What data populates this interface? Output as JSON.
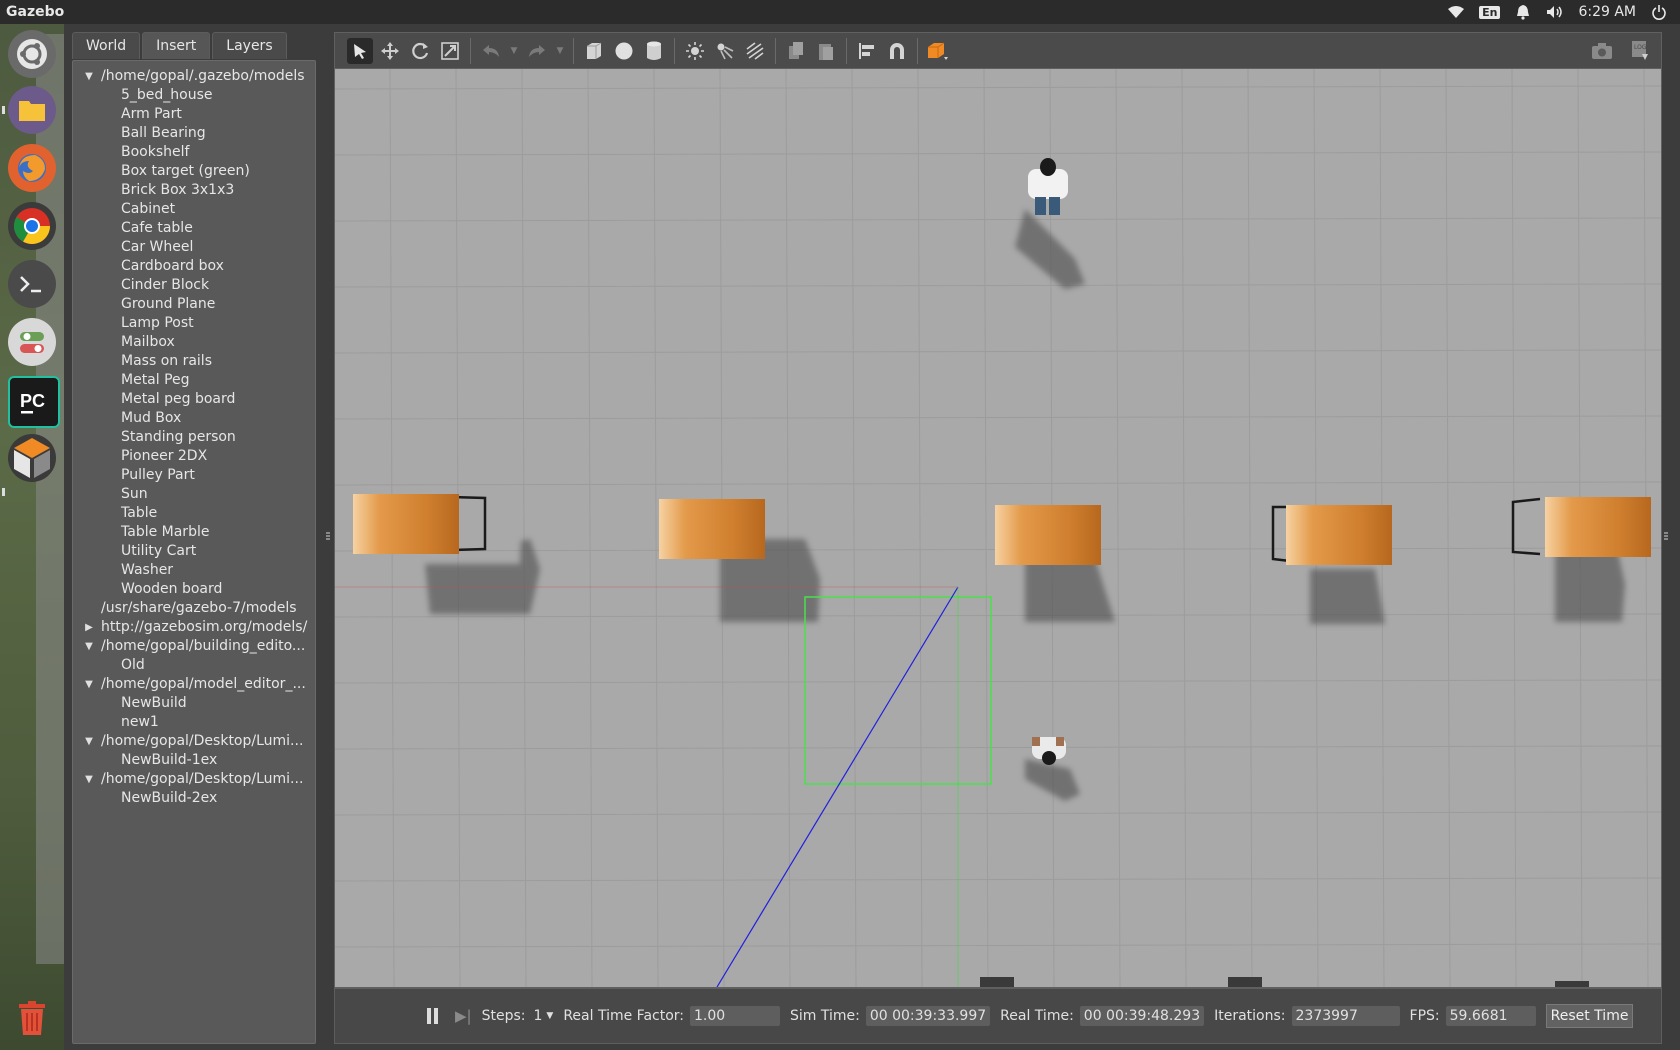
{
  "topbar": {
    "title": "Gazebo",
    "keyboard_layout": "En",
    "clock": "6:29 AM",
    "icons": [
      "wifi-icon",
      "keyboard-icon",
      "bell-icon",
      "volume-icon",
      "power-icon"
    ]
  },
  "launcher": {
    "items": [
      "ubuntu-dash",
      "files",
      "firefox",
      "chrome",
      "terminal",
      "settings-toggle",
      "pycharm",
      "gazebo"
    ],
    "trash": "trash-icon"
  },
  "side_panel": {
    "tabs": [
      "World",
      "Insert",
      "Layers"
    ],
    "active_tab": "Insert",
    "tree": {
      "root1": "/home/gopal/.gazebo/models",
      "root1_items": [
        "5_bed_house",
        "Arm Part",
        "Ball Bearing",
        "Bookshelf",
        "Box target (green)",
        "Brick Box 3x1x3",
        "Cabinet",
        "Cafe table",
        "Car Wheel",
        "Cardboard box",
        "Cinder Block",
        "Ground Plane",
        "Lamp Post",
        "Mailbox",
        "Mass on rails",
        "Metal Peg",
        "Metal peg board",
        "Mud Box",
        "Standing person",
        "Pioneer 2DX",
        "Pulley Part",
        "Sun",
        "Table",
        "Table Marble",
        "Utility Cart",
        "Washer",
        "Wooden board"
      ],
      "root2": "/usr/share/gazebo-7/models",
      "root3": "http://gazebosim.org/models/",
      "root4": "/home/gopal/building_edito...",
      "root4_items": [
        "Old"
      ],
      "root5": "/home/gopal/model_editor_...",
      "root5_items": [
        "NewBuild",
        "new1"
      ],
      "root6": "/home/gopal/Desktop/Lumi...",
      "root6_items": [
        "NewBuild-1ex"
      ],
      "root7": "/home/gopal/Desktop/Lumi...",
      "root7_items": [
        "NewBuild-2ex"
      ]
    }
  },
  "toolbar": {
    "tools": [
      "select-tool",
      "translate-tool",
      "rotate-tool",
      "scale-tool",
      "undo",
      "undo-menu",
      "redo",
      "redo-menu",
      "box-shape",
      "sphere-shape",
      "cylinder-shape",
      "point-light",
      "spot-light",
      "directional-light",
      "copy",
      "paste",
      "align",
      "snap",
      "view-angle"
    ],
    "right_tools": [
      "screenshot",
      "log"
    ]
  },
  "status": {
    "steps_label": "Steps:",
    "steps_value": "1",
    "rtf_label": "Real Time Factor:",
    "rtf_value": "1.00",
    "sim_time_label": "Sim Time:",
    "sim_time_value": "00 00:39:33.997",
    "real_time_label": "Real Time:",
    "real_time_value": "00 00:39:48.293",
    "iterations_label": "Iterations:",
    "iterations_value": "2373997",
    "fps_label": "FPS:",
    "fps_value": "59.6681",
    "reset_label": "Reset Time"
  },
  "scene": {
    "objects": [
      "person-standing",
      "person-lying",
      "table-1",
      "table-2",
      "table-3",
      "table-4",
      "table-5",
      "selection-box",
      "z-axis-line"
    ],
    "colors": {
      "ground": "#a9a9a9",
      "grid": "#9a9a9a",
      "wood": "#d08a3a",
      "selection": "#3adf3a",
      "axis_blue": "#2020e0"
    }
  }
}
